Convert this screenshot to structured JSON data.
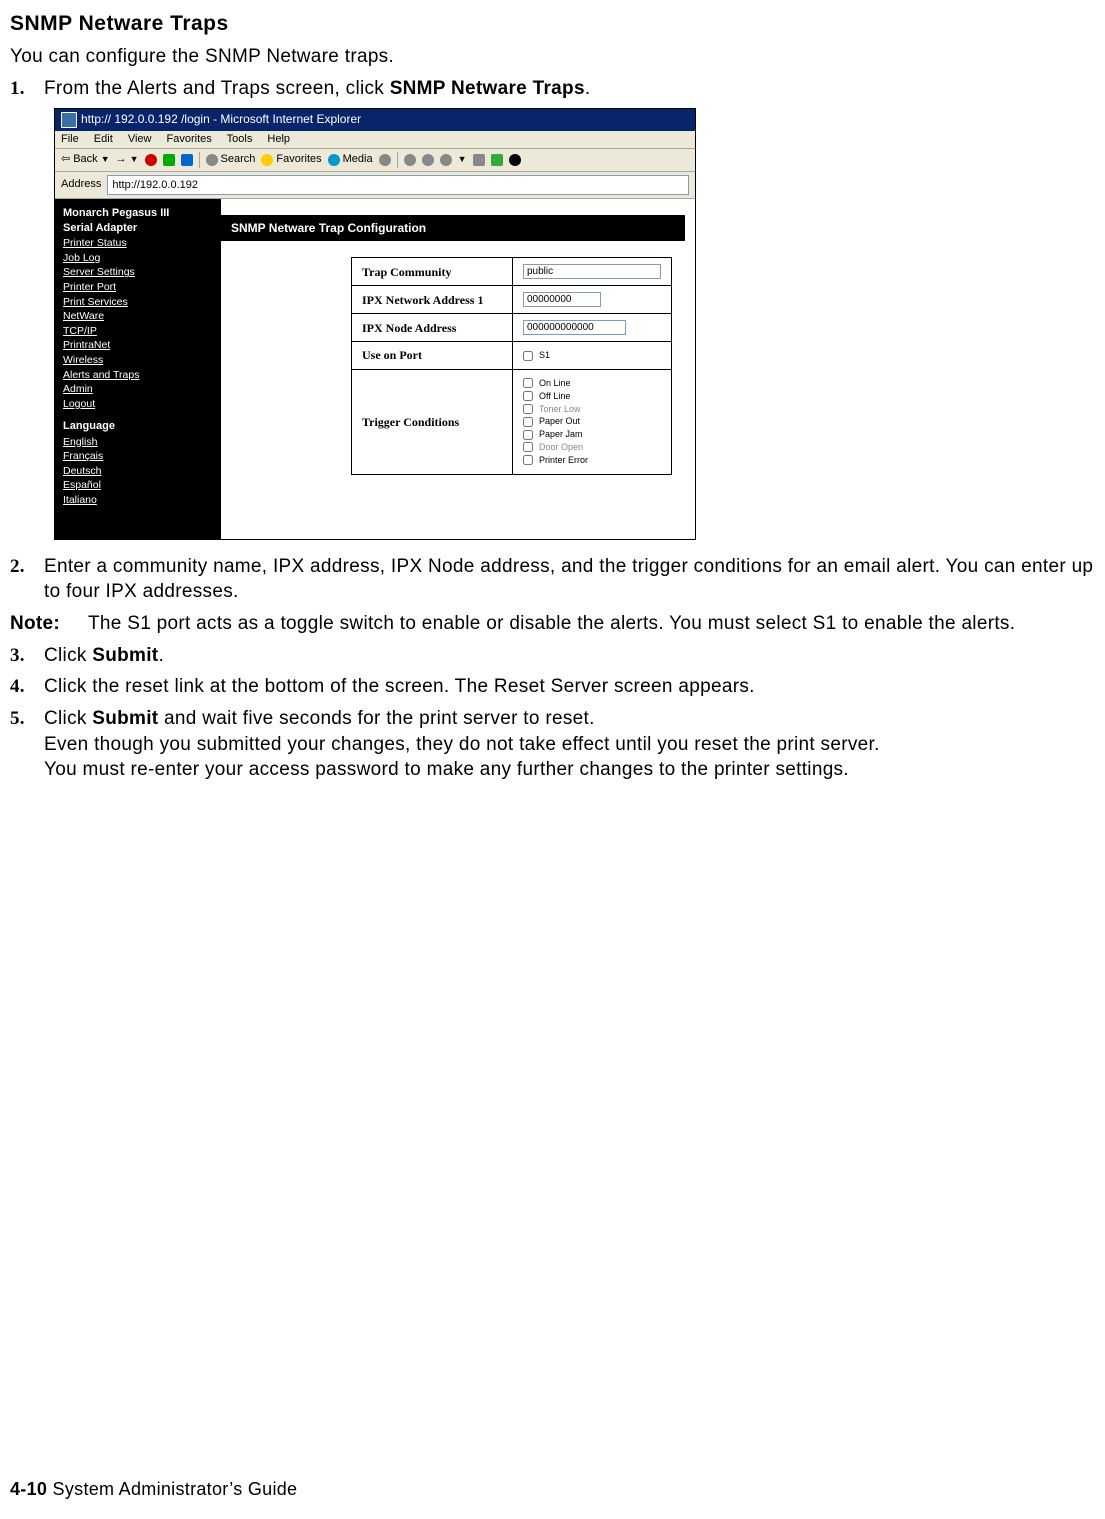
{
  "section_title": "SNMP Netware Traps",
  "intro": "You can configure the SNMP Netware traps.",
  "steps": {
    "s1_pre": "From the Alerts and Traps screen, click ",
    "s1_bold": "SNMP Netware Traps",
    "s1_post": ".",
    "s2": "Enter a community name, IPX address, IPX Node address, and the trigger conditions for an email alert.  You can enter up to four IPX addresses.",
    "s3_pre": "Click ",
    "s3_bold": "Submit",
    "s3_post": ".",
    "s4": "Click the reset link at the bottom of the screen.  The Reset Server screen appears.",
    "s5_pre": "Click ",
    "s5_bold": "Submit",
    "s5_post": " and wait five seconds for the print server to reset.",
    "s5_line2": "Even though you submitted your changes, they do not take effect until you reset the print server.",
    "s5_line3": "You must re-enter your access password to make any further changes to the printer settings."
  },
  "note": {
    "label": "Note:",
    "text": "The S1 port acts as a toggle switch to enable or disable the alerts. You must select S1 to enable the alerts."
  },
  "browser": {
    "title": "http:// 192.0.0.192 /login - Microsoft Internet Explorer",
    "menus": [
      "File",
      "Edit",
      "View",
      "Favorites",
      "Tools",
      "Help"
    ],
    "toolbar": {
      "back": "Back",
      "search": "Search",
      "favorites": "Favorites",
      "media": "Media"
    },
    "address_label": "Address",
    "address_value": "http://192.0.0.192",
    "sidebar": {
      "hdr1": "Monarch Pegasus III",
      "hdr2": "Serial Adapter",
      "links": [
        "Printer Status",
        "Job Log",
        "Server Settings",
        "Printer Port",
        "Print Services",
        "NetWare",
        "TCP/IP",
        "PrintraNet",
        "Wireless",
        "Alerts and Traps",
        "Admin",
        "Logout"
      ],
      "lang_label": "Language",
      "langs": [
        "English",
        "Français",
        "Deutsch",
        "Español",
        "Italiano"
      ]
    },
    "page_title": "SNMP Netware Trap Configuration",
    "fields": {
      "trap_community_label": "Trap Community",
      "trap_community_value": "public",
      "ipx_net_label": "IPX Network Address 1",
      "ipx_net_value": "00000000",
      "ipx_node_label": "IPX Node Address",
      "ipx_node_value": "000000000000",
      "use_port_label": "Use on Port",
      "use_port_opt": "S1",
      "triggers_label": "Trigger Conditions",
      "triggers": [
        "On Line",
        "Off Line",
        "Toner Low",
        "Paper Out",
        "Paper Jam",
        "Door Open",
        "Printer Error"
      ]
    }
  },
  "footer": {
    "page": "4-10",
    "book": "  System Administrator’s Guide"
  }
}
